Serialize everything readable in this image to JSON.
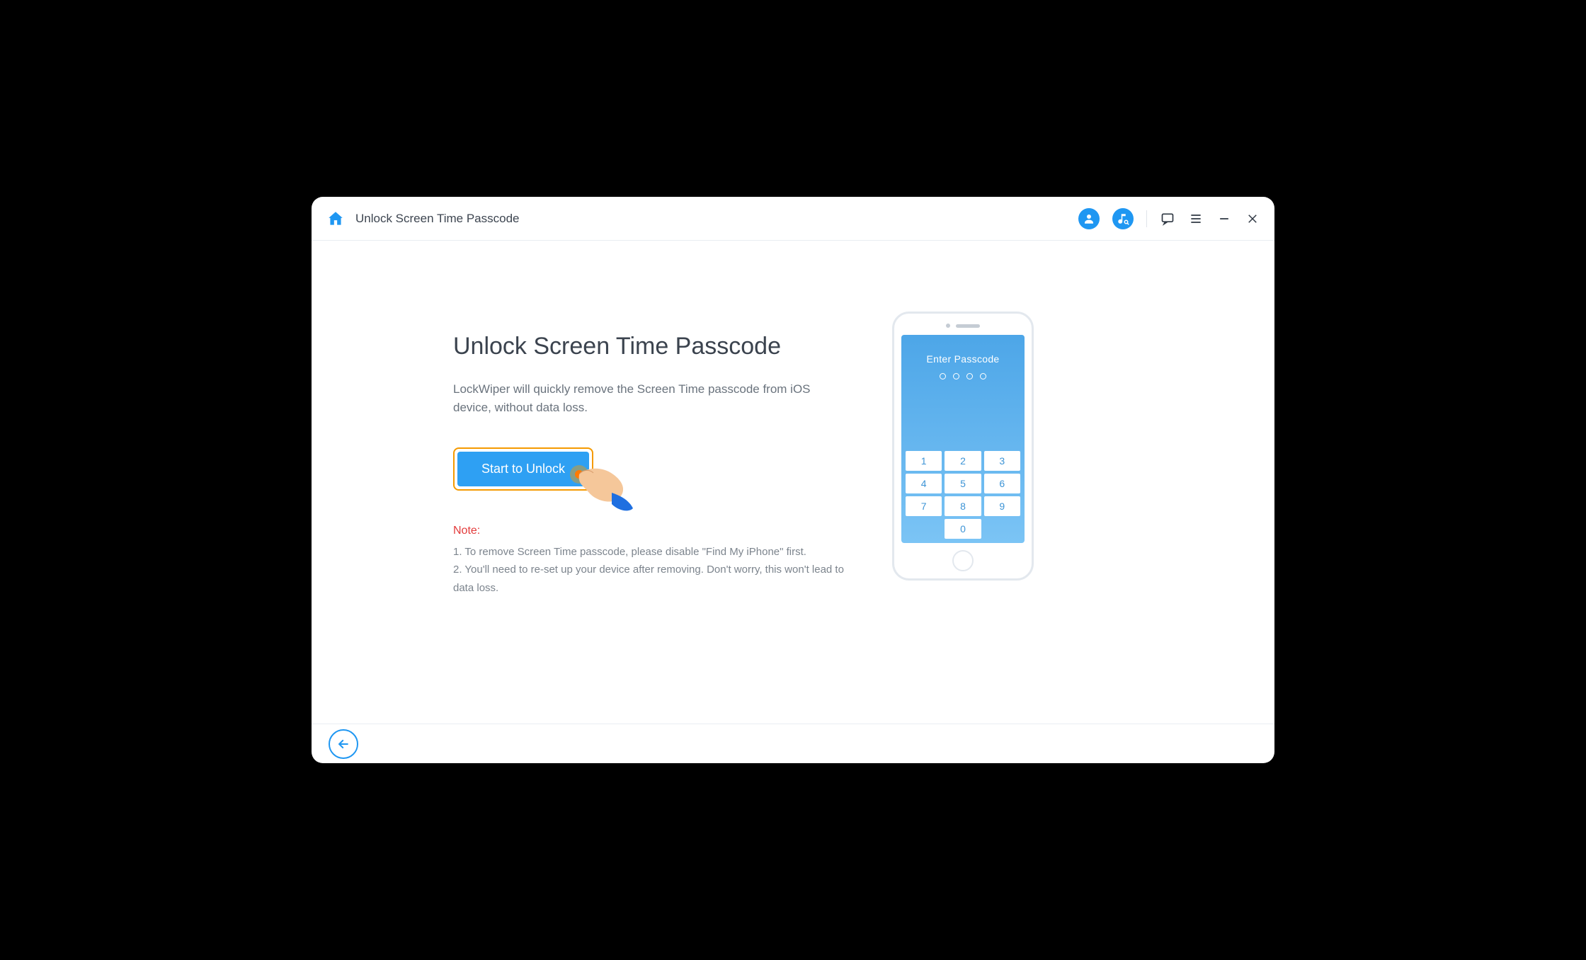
{
  "header": {
    "title": "Unlock Screen Time Passcode"
  },
  "main": {
    "heading": "Unlock Screen Time Passcode",
    "description": "LockWiper will quickly remove the Screen Time passcode from iOS device, without data loss.",
    "start_button": "Start to Unlock",
    "note_label": "Note:",
    "notes": [
      "1. To remove Screen Time passcode, please disable \"Find My iPhone\" first.",
      "2. You'll need to re-set up your device after removing. Don't worry, this won't lead to data loss."
    ]
  },
  "phone": {
    "enter_label": "Enter Passcode",
    "keys": [
      "1",
      "2",
      "3",
      "4",
      "5",
      "6",
      "7",
      "8",
      "9",
      "0"
    ]
  },
  "colors": {
    "accent": "#1f97f2",
    "highlight": "#f59a00",
    "danger": "#e33b3b"
  }
}
